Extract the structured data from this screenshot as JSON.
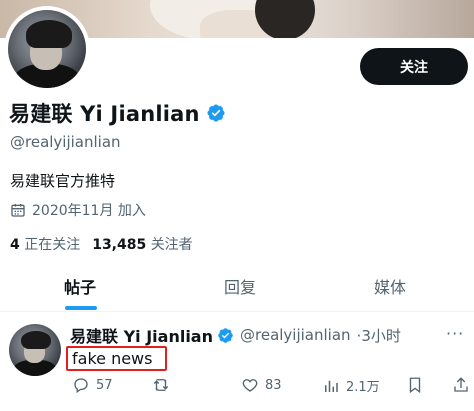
{
  "profile": {
    "display_name": "易建联 Yi Jianlian",
    "handle": "@realyijianlian",
    "bio": "易建联官方推特",
    "joined": "2020年11月 加入",
    "following_count": "4",
    "following_label": "正在关注",
    "followers_count": "13,485",
    "followers_label": "关注者",
    "verified_icon": "verified-badge-icon"
  },
  "header": {
    "follow_label": "关注"
  },
  "tabs": [
    {
      "label": "帖子",
      "active": true
    },
    {
      "label": "回复",
      "active": false
    },
    {
      "label": "媒体",
      "active": false
    }
  ],
  "tweet": {
    "author": "易建联 Yi Jianlian",
    "handle": "@realyijianlian",
    "time": "·3小时",
    "text": "fake news",
    "highlight_color": "#e0201c",
    "actions": {
      "replies": "57",
      "retweets": "",
      "likes": "83",
      "views": "2.1万"
    }
  },
  "colors": {
    "accent": "#1d9bf0",
    "text": "#0f1419",
    "muted": "#536471"
  }
}
